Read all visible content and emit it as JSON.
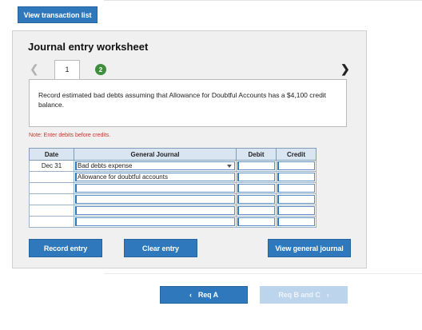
{
  "top": {
    "view_transactions_label": "View transaction list"
  },
  "worksheet": {
    "title": "Journal entry worksheet",
    "tabs": [
      {
        "label": "1"
      },
      {
        "label": "2"
      }
    ],
    "description": "Record estimated bad debts assuming that Allowance for Doubtful Accounts has a $4,100 credit balance.",
    "note": "Note: Enter debits before credits.",
    "table": {
      "headers": {
        "date": "Date",
        "journal": "General Journal",
        "debit": "Debit",
        "credit": "Credit"
      },
      "rows": [
        {
          "date": "Dec 31",
          "account": "Bad debts expense",
          "debit": "",
          "credit": ""
        },
        {
          "date": "",
          "account": "Allowance for doubtful accounts",
          "debit": "",
          "credit": ""
        },
        {
          "date": "",
          "account": "",
          "debit": "",
          "credit": ""
        },
        {
          "date": "",
          "account": "",
          "debit": "",
          "credit": ""
        },
        {
          "date": "",
          "account": "",
          "debit": "",
          "credit": ""
        },
        {
          "date": "",
          "account": "",
          "debit": "",
          "credit": ""
        }
      ]
    },
    "buttons": {
      "record": "Record entry",
      "clear": "Clear entry",
      "view_general": "View general journal"
    }
  },
  "footer": {
    "prev_label": "Req A",
    "next_label": "Req B and C"
  },
  "colors": {
    "accent": "#2f78bc",
    "disabled": "#bcd4ec",
    "step_done": "#3e8e3e",
    "note": "#c0392b"
  }
}
